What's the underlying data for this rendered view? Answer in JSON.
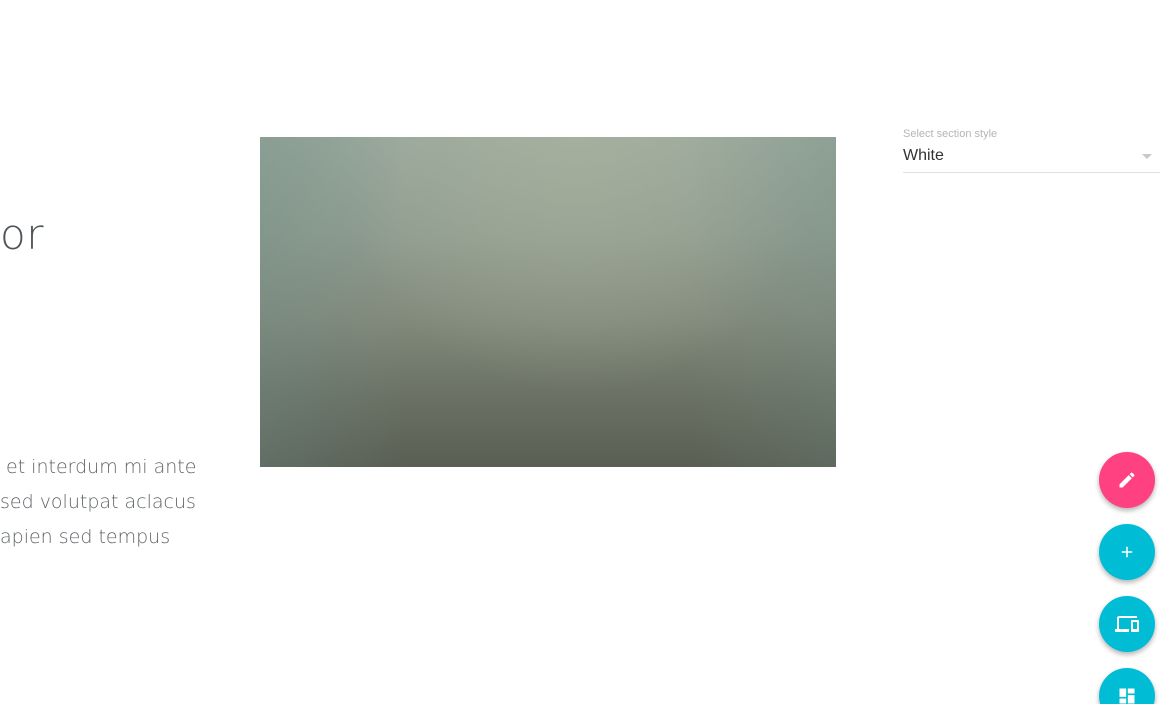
{
  "content": {
    "heading_fragment": "or",
    "body_lines": [
      "et interdum mi ante",
      "sed volutpat aclacus",
      "apien sed tempus"
    ]
  },
  "section_style": {
    "label": "Select section style",
    "selected": "White"
  },
  "fabs": [
    {
      "name": "edit",
      "icon": "pencil-icon",
      "color": "#ff4081"
    },
    {
      "name": "add",
      "icon": "plus-icon",
      "color": "#00bcd4"
    },
    {
      "name": "devices",
      "icon": "devices-icon",
      "color": "#00bcd4"
    },
    {
      "name": "layout",
      "icon": "dashboard-icon",
      "color": "#00bcd4"
    }
  ]
}
